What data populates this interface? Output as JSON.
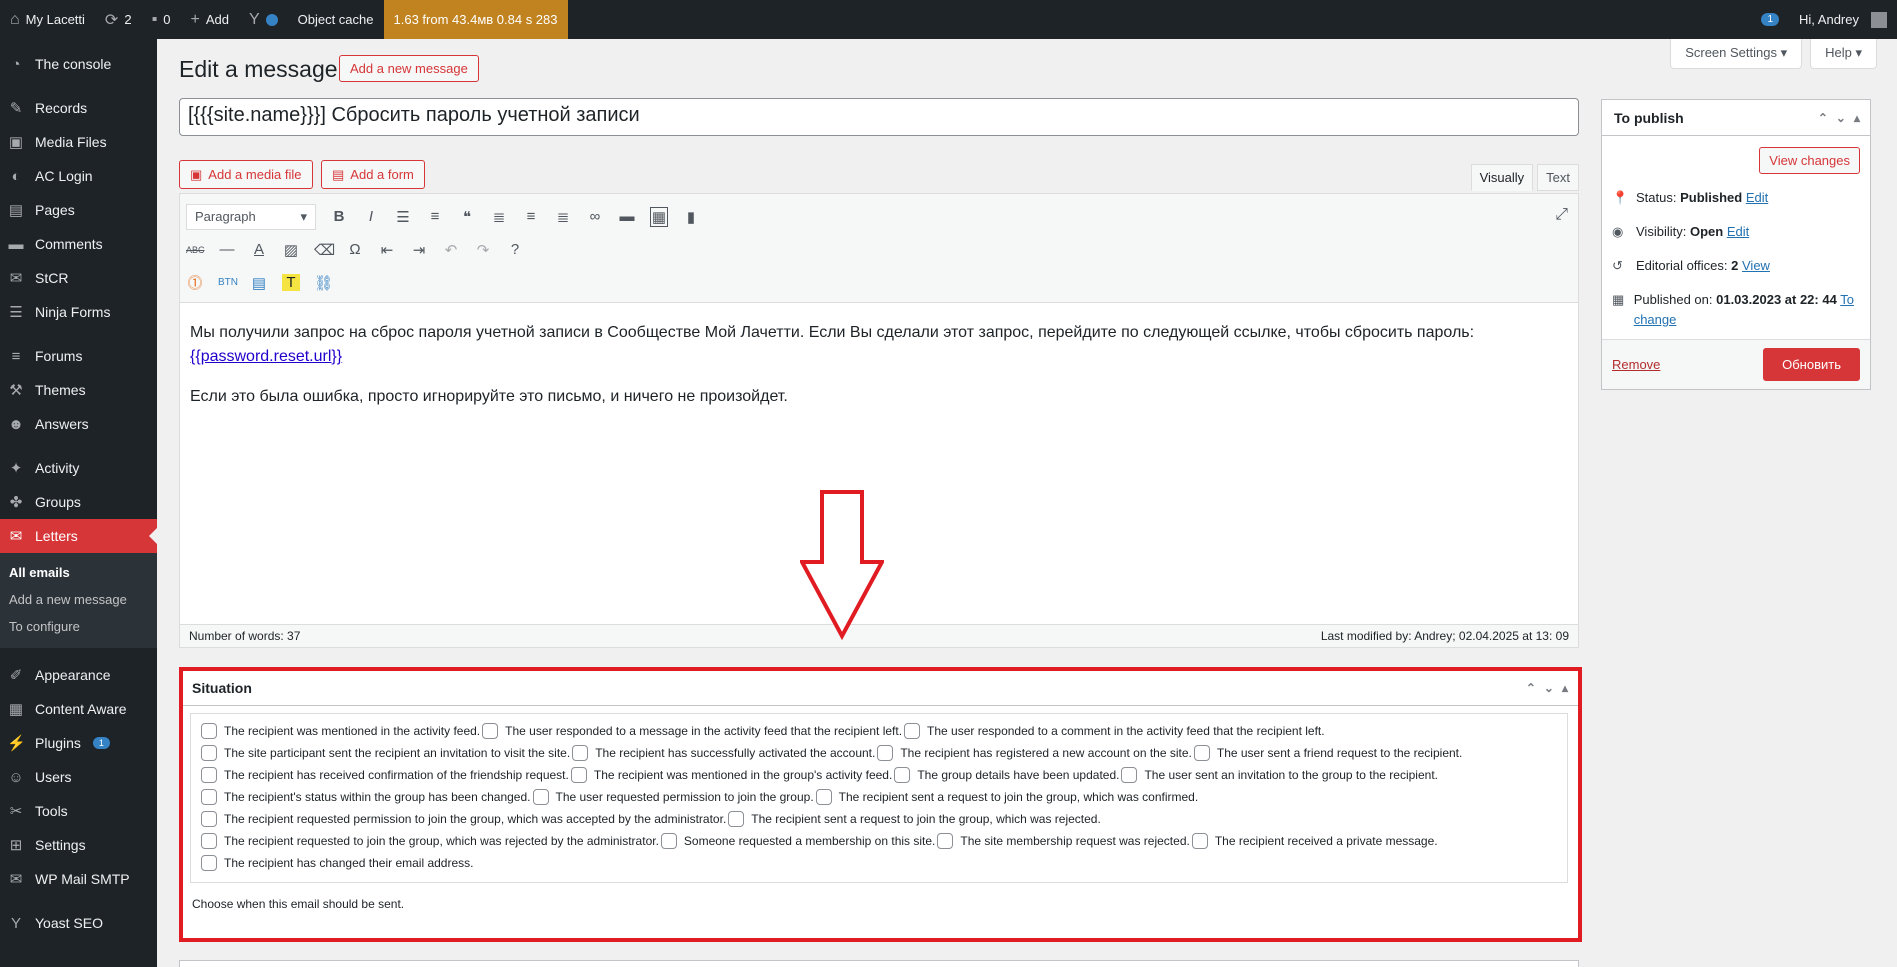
{
  "adminbar": {
    "site_name": "My Lacetti",
    "updates_count": "2",
    "comments_count": "0",
    "add_label": "Add",
    "object_cache": "Object cache",
    "perf": "1.63 from 43.4мв 0.84 s 283",
    "notif_count": "1",
    "greeting": "Hi, Andrey"
  },
  "sidebar": {
    "items": [
      {
        "label": "The console",
        "icon": "dashboard-icon"
      },
      {
        "label": "Records",
        "icon": "pin-icon"
      },
      {
        "label": "Media Files",
        "icon": "media-icon"
      },
      {
        "label": "AC Login",
        "icon": "login-icon"
      },
      {
        "label": "Pages",
        "icon": "pages-icon"
      },
      {
        "label": "Comments",
        "icon": "comments-icon"
      },
      {
        "label": "StCR",
        "icon": "mail-icon"
      },
      {
        "label": "Ninja Forms",
        "icon": "forms-icon"
      },
      {
        "label": "Forums",
        "icon": "forums-icon"
      },
      {
        "label": "Themes",
        "icon": "themes-icon"
      },
      {
        "label": "Answers",
        "icon": "answers-icon"
      },
      {
        "label": "Activity",
        "icon": "activity-icon"
      },
      {
        "label": "Groups",
        "icon": "groups-icon"
      },
      {
        "label": "Letters",
        "icon": "letters-icon"
      },
      {
        "label": "Appearance",
        "icon": "appearance-icon"
      },
      {
        "label": "Content Aware",
        "icon": "content-aware-icon"
      },
      {
        "label": "Plugins",
        "icon": "plugins-icon",
        "count": "1"
      },
      {
        "label": "Users",
        "icon": "users-icon"
      },
      {
        "label": "Tools",
        "icon": "tools-icon"
      },
      {
        "label": "Settings",
        "icon": "settings-icon"
      },
      {
        "label": "WP Mail SMTP",
        "icon": "smtp-icon"
      },
      {
        "label": "Yoast SEO",
        "icon": "yoast-icon"
      }
    ],
    "submenu": [
      "All emails",
      "Add a new message",
      "To configure"
    ]
  },
  "screen_meta": {
    "screen_options": "Screen Settings ▾",
    "help": "Help ▾"
  },
  "header": {
    "title": "Edit a message",
    "add_new": "Add a new message"
  },
  "title_value": "[{{{site.name}}}] Сбросить пароль учетной записи",
  "editor": {
    "add_media": "Add a media file",
    "add_form": "Add a form",
    "tab_visual": "Visually",
    "tab_text": "Text",
    "format_select": "Paragraph",
    "para1": "Мы получили запрос на сброс пароля учетной записи в Сообществе Мой Лачетти. Если Вы сделали этот запрос, перейдите по следующей ссылке, чтобы сбросить пароль:",
    "link": "{{password.reset.url}}",
    "para2": "Если это была ошибка, просто игнорируйте это письмо, и ничего не произойдет.",
    "word_count": "Number of words: 37",
    "last_modified": "Last modified by: Andrey; 02.04.2025 at 13: 09"
  },
  "publish": {
    "title": "To publish",
    "view_changes": "View changes",
    "status_label": "Status: ",
    "status_value": "Published",
    "edit": "Edit",
    "visibility_label": "Visibility: ",
    "visibility_value": "Open",
    "revisions_label": "Editorial offices: ",
    "revisions_value": "2",
    "view": "View",
    "published_label": "Published on: ",
    "published_value": "01.03.2023 at 22: 44",
    "to_change": "To change",
    "remove": "Remove",
    "update": "Обновить"
  },
  "situation": {
    "title": "Situation",
    "rows": [
      [
        "The recipient was mentioned in the activity feed.",
        "The user responded to a message in the activity feed that the recipient left.",
        "The user responded to a comment in the activity feed that the recipient left."
      ],
      [
        "The site participant sent the recipient an invitation to visit the site.",
        "The recipient has successfully activated the account.",
        "The recipient has registered a new account on the site.",
        "The user sent a friend request to the recipient."
      ],
      [
        "The recipient has received confirmation of the friendship request.",
        "The recipient was mentioned in the group's activity feed.",
        "The group details have been updated.",
        "The user sent an invitation to the group to the recipient."
      ],
      [
        "The recipient's status within the group has been changed.",
        "The user requested permission to join the group.",
        "The recipient sent a request to join the group, which was confirmed."
      ],
      [
        "The recipient requested permission to join the group, which was accepted by the administrator.",
        "The recipient sent a request to join the group, which was rejected."
      ],
      [
        "The recipient requested to join the group, which was rejected by the administrator.",
        "Someone requested a membership on this site.",
        "The site membership request was rejected.",
        "The recipient received a private message."
      ],
      [
        "The recipient has changed their email address."
      ]
    ],
    "description": "Choose when this email should be sent."
  },
  "colors": {
    "accent": "#d63638",
    "highlight": "#e11b22",
    "adminbar": "#1d2327"
  }
}
